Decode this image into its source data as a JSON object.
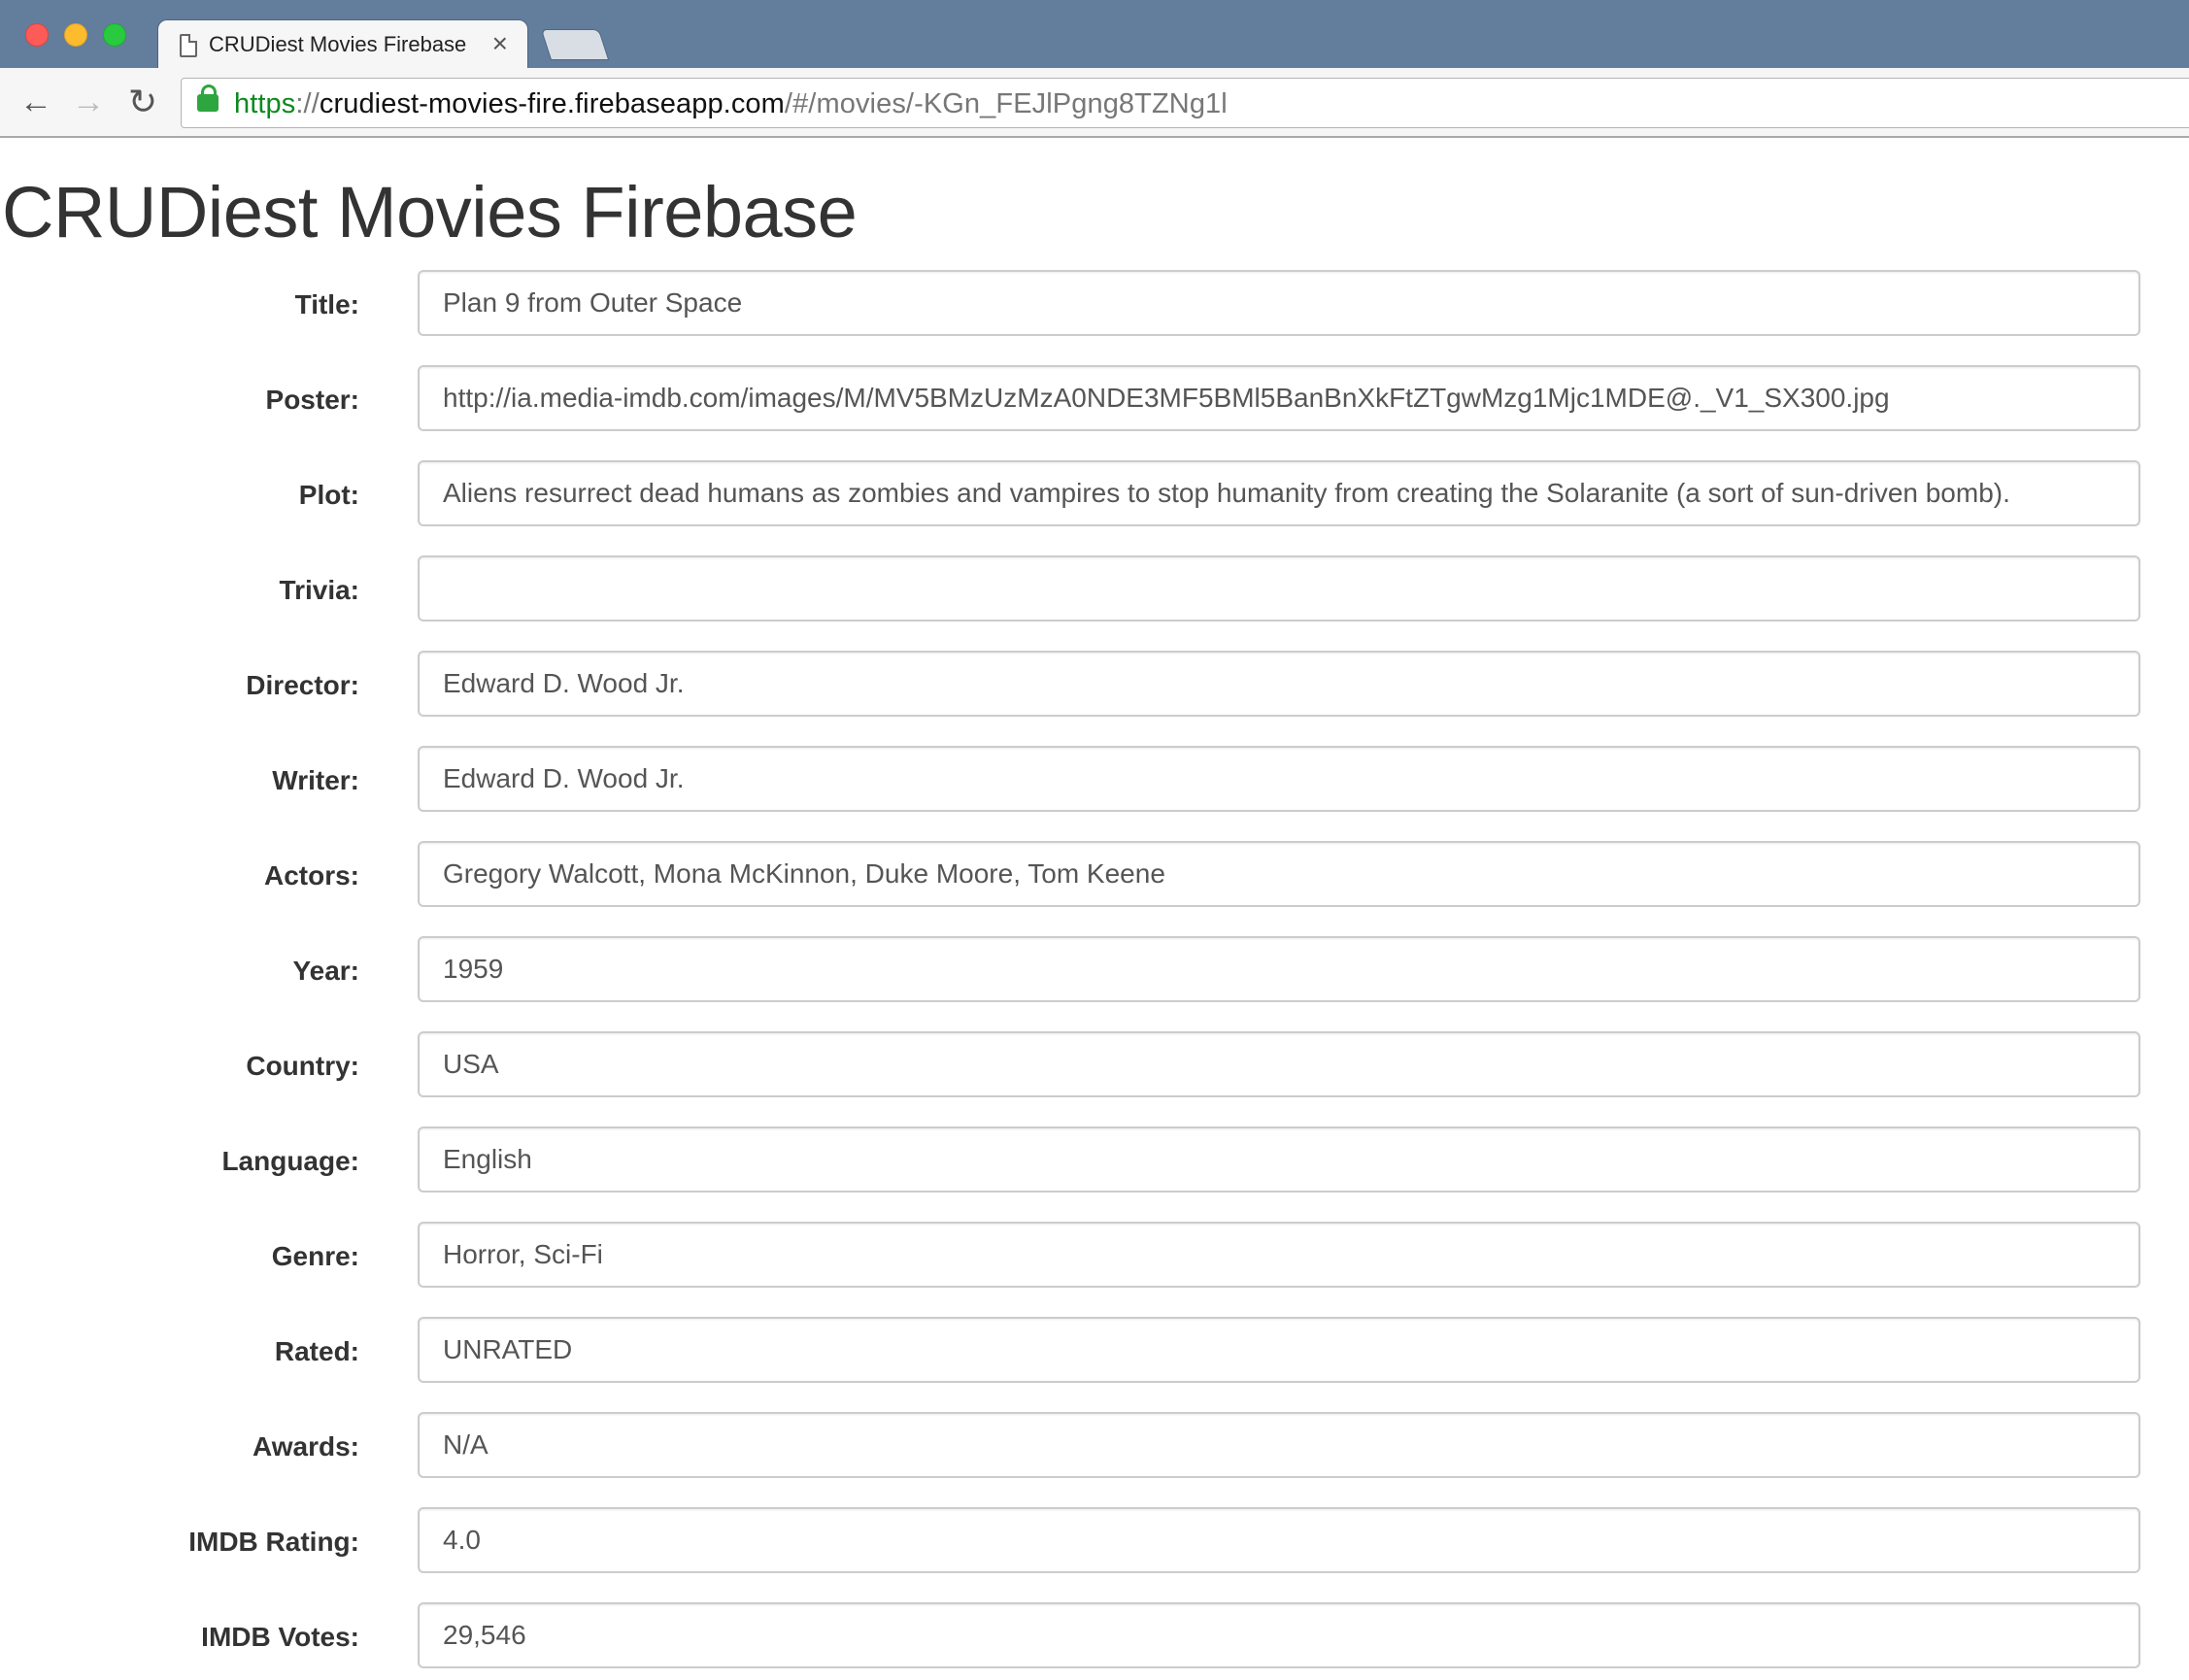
{
  "browser": {
    "tab_title": "CRUDiest Movies Firebase",
    "tab_close": "×",
    "url_scheme": "https",
    "url_sep": "://",
    "url_host": "crudiest-movies-fire.firebaseapp.com",
    "url_path": "/#/movies/-KGn_FEJlPgng8TZNg1l",
    "nav": {
      "back": "←",
      "forward": "→",
      "reload": "↻"
    }
  },
  "page": {
    "title": "CRUDiest Movies Firebase"
  },
  "form": {
    "fields": [
      {
        "label": "Title:",
        "value": "Plan 9 from Outer Space"
      },
      {
        "label": "Poster:",
        "value": "http://ia.media-imdb.com/images/M/MV5BMzUzMzA0NDE3MF5BMl5BanBnXkFtZTgwMzg1Mjc1MDE@._V1_SX300.jpg"
      },
      {
        "label": "Plot:",
        "value": "Aliens resurrect dead humans as zombies and vampires to stop humanity from creating the Solaranite (a sort of sun-driven bomb)."
      },
      {
        "label": "Trivia:",
        "value": ""
      },
      {
        "label": "Director:",
        "value": "Edward D. Wood Jr."
      },
      {
        "label": "Writer:",
        "value": "Edward D. Wood Jr."
      },
      {
        "label": "Actors:",
        "value": "Gregory Walcott, Mona McKinnon, Duke Moore, Tom Keene"
      },
      {
        "label": "Year:",
        "value": "1959"
      },
      {
        "label": "Country:",
        "value": "USA"
      },
      {
        "label": "Language:",
        "value": "English"
      },
      {
        "label": "Genre:",
        "value": "Horror, Sci-Fi"
      },
      {
        "label": "Rated:",
        "value": "UNRATED"
      },
      {
        "label": "Awards:",
        "value": "N/A"
      },
      {
        "label": "IMDB Rating:",
        "value": "4.0"
      },
      {
        "label": "IMDB Votes:",
        "value": "29,546"
      }
    ]
  }
}
